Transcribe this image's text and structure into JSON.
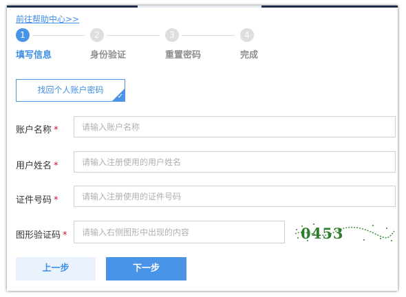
{
  "help_link": "前往帮助中心>>",
  "steps": [
    {
      "number": "1",
      "label": "填写信息"
    },
    {
      "number": "2",
      "label": "身份验证"
    },
    {
      "number": "3",
      "label": "重置密码"
    },
    {
      "number": "4",
      "label": "完成"
    }
  ],
  "tab": {
    "label": "找回个人账户密码",
    "selected": true
  },
  "fields": {
    "account": {
      "label": "账户名称",
      "required_mark": "*",
      "placeholder": "请输入账户名称",
      "value": ""
    },
    "name": {
      "label": "用户姓名",
      "required_mark": "*",
      "placeholder": "请输入注册使用的用户姓名",
      "value": ""
    },
    "id_number": {
      "label": "证件号码",
      "required_mark": "*",
      "placeholder": "请输入注册使用的证件号码",
      "value": ""
    },
    "captcha": {
      "label": "图形验证码",
      "required_mark": "*",
      "placeholder": "请输入右侧图形中出现的内容",
      "value": ""
    }
  },
  "captcha_image": {
    "text": "0453"
  },
  "buttons": {
    "prev": "上一步",
    "next": "下一步"
  },
  "colors": {
    "accent": "#4a94e8",
    "link": "#3d8ee6",
    "required": "#c8102e",
    "inactive_step": "#dedede",
    "captcha_green": "#2e7d2e"
  },
  "current_step": 1
}
